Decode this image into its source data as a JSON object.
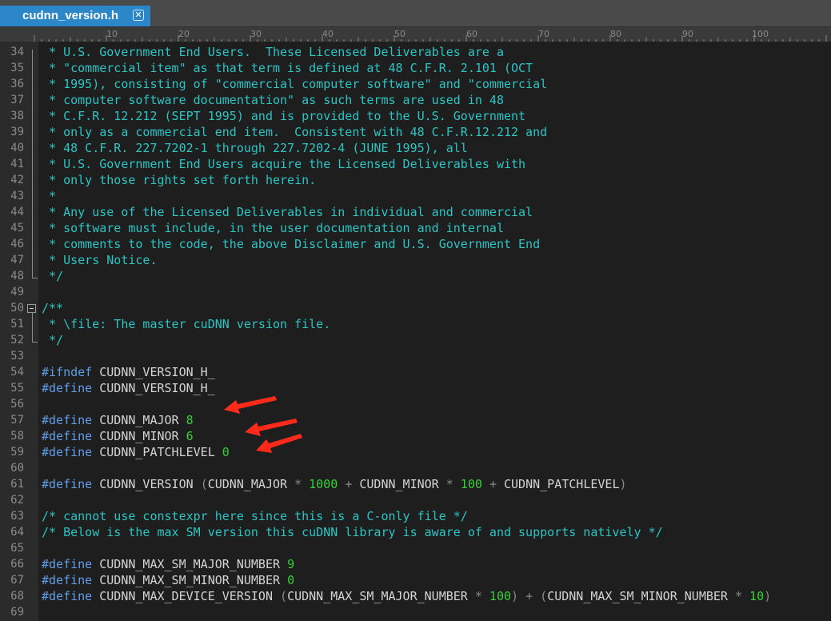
{
  "tab": {
    "title": "cudnn_version.h",
    "close_glyph": "✕"
  },
  "ruler": {
    "marks": [
      "10",
      "20",
      "30",
      "40",
      "50",
      "60",
      "70",
      "80",
      "90",
      "100"
    ]
  },
  "editor": {
    "lines": [
      {
        "num": "34",
        "tokens": [
          {
            "t": " * U.S. Government End Users.  These Licensed Deliverables are a",
            "c": "comment"
          }
        ]
      },
      {
        "num": "35",
        "tokens": [
          {
            "t": " * \"commercial item\" as that term is defined at 48 C.F.R. 2.101 (OCT",
            "c": "comment"
          }
        ]
      },
      {
        "num": "36",
        "tokens": [
          {
            "t": " * 1995), consisting of \"commercial computer software\" and \"commercial",
            "c": "comment"
          }
        ]
      },
      {
        "num": "37",
        "tokens": [
          {
            "t": " * computer software documentation\" as such terms are used in 48",
            "c": "comment"
          }
        ]
      },
      {
        "num": "38",
        "tokens": [
          {
            "t": " * C.F.R. 12.212 (SEPT 1995) and is provided to the U.S. Government",
            "c": "comment"
          }
        ]
      },
      {
        "num": "39",
        "tokens": [
          {
            "t": " * only as a commercial end item.  Consistent with 48 C.F.R.12.212 and",
            "c": "comment"
          }
        ]
      },
      {
        "num": "40",
        "tokens": [
          {
            "t": " * 48 C.F.R. 227.7202-1 through 227.7202-4 (JUNE 1995), all",
            "c": "comment"
          }
        ]
      },
      {
        "num": "41",
        "tokens": [
          {
            "t": " * U.S. Government End Users acquire the Licensed Deliverables with",
            "c": "comment"
          }
        ]
      },
      {
        "num": "42",
        "tokens": [
          {
            "t": " * only those rights set forth herein.",
            "c": "comment"
          }
        ]
      },
      {
        "num": "43",
        "tokens": [
          {
            "t": " *",
            "c": "comment"
          }
        ]
      },
      {
        "num": "44",
        "tokens": [
          {
            "t": " * Any use of the Licensed Deliverables in individual and commercial",
            "c": "comment"
          }
        ]
      },
      {
        "num": "45",
        "tokens": [
          {
            "t": " * software must include, in the user documentation and internal",
            "c": "comment"
          }
        ]
      },
      {
        "num": "46",
        "tokens": [
          {
            "t": " * comments to the code, the above Disclaimer and U.S. Government End",
            "c": "comment"
          }
        ]
      },
      {
        "num": "47",
        "tokens": [
          {
            "t": " * Users Notice.",
            "c": "comment"
          }
        ]
      },
      {
        "num": "48",
        "tokens": [
          {
            "t": " */",
            "c": "comment"
          }
        ]
      },
      {
        "num": "49",
        "tokens": []
      },
      {
        "num": "50",
        "tokens": [
          {
            "t": "/**",
            "c": "comment"
          }
        ]
      },
      {
        "num": "51",
        "tokens": [
          {
            "t": " * \\file: The master cuDNN version file.",
            "c": "comment"
          }
        ]
      },
      {
        "num": "52",
        "tokens": [
          {
            "t": " */",
            "c": "comment"
          }
        ]
      },
      {
        "num": "53",
        "tokens": []
      },
      {
        "num": "54",
        "tokens": [
          {
            "t": "#ifndef",
            "c": "pre"
          },
          {
            "t": " CUDNN_VERSION_H_",
            "c": "ident"
          }
        ]
      },
      {
        "num": "55",
        "tokens": [
          {
            "t": "#define",
            "c": "pre"
          },
          {
            "t": " CUDNN_VERSION_H_",
            "c": "ident"
          }
        ]
      },
      {
        "num": "56",
        "tokens": []
      },
      {
        "num": "57",
        "tokens": [
          {
            "t": "#define",
            "c": "pre"
          },
          {
            "t": " CUDNN_MAJOR ",
            "c": "ident"
          },
          {
            "t": "8",
            "c": "num"
          }
        ]
      },
      {
        "num": "58",
        "tokens": [
          {
            "t": "#define",
            "c": "pre"
          },
          {
            "t": " CUDNN_MINOR ",
            "c": "ident"
          },
          {
            "t": "6",
            "c": "num"
          }
        ]
      },
      {
        "num": "59",
        "tokens": [
          {
            "t": "#define",
            "c": "pre"
          },
          {
            "t": " CUDNN_PATCHLEVEL ",
            "c": "ident"
          },
          {
            "t": "0",
            "c": "num"
          }
        ]
      },
      {
        "num": "60",
        "tokens": []
      },
      {
        "num": "61",
        "tokens": [
          {
            "t": "#define",
            "c": "pre"
          },
          {
            "t": " CUDNN_VERSION ",
            "c": "ident"
          },
          {
            "t": "(",
            "c": "op"
          },
          {
            "t": "CUDNN_MAJOR ",
            "c": "ident"
          },
          {
            "t": "*",
            "c": "op"
          },
          {
            "t": " 1000 ",
            "c": "num"
          },
          {
            "t": "+",
            "c": "op"
          },
          {
            "t": " CUDNN_MINOR ",
            "c": "ident"
          },
          {
            "t": "*",
            "c": "op"
          },
          {
            "t": " 100 ",
            "c": "num"
          },
          {
            "t": "+",
            "c": "op"
          },
          {
            "t": " CUDNN_PATCHLEVEL",
            "c": "ident"
          },
          {
            "t": ")",
            "c": "op"
          }
        ]
      },
      {
        "num": "62",
        "tokens": []
      },
      {
        "num": "63",
        "tokens": [
          {
            "t": "/* cannot use constexpr here since this is a C-only file */",
            "c": "comment"
          }
        ]
      },
      {
        "num": "64",
        "tokens": [
          {
            "t": "/* Below is the max SM version this cuDNN library is aware of and supports natively */",
            "c": "comment"
          }
        ]
      },
      {
        "num": "65",
        "tokens": []
      },
      {
        "num": "66",
        "tokens": [
          {
            "t": "#define",
            "c": "pre"
          },
          {
            "t": " CUDNN_MAX_SM_MAJOR_NUMBER ",
            "c": "ident"
          },
          {
            "t": "9",
            "c": "num"
          }
        ]
      },
      {
        "num": "67",
        "tokens": [
          {
            "t": "#define",
            "c": "pre"
          },
          {
            "t": " CUDNN_MAX_SM_MINOR_NUMBER ",
            "c": "ident"
          },
          {
            "t": "0",
            "c": "num"
          }
        ]
      },
      {
        "num": "68",
        "tokens": [
          {
            "t": "#define",
            "c": "pre"
          },
          {
            "t": " CUDNN_MAX_DEVICE_VERSION ",
            "c": "ident"
          },
          {
            "t": "(",
            "c": "op"
          },
          {
            "t": "CUDNN_MAX_SM_MAJOR_NUMBER ",
            "c": "ident"
          },
          {
            "t": "*",
            "c": "op"
          },
          {
            "t": " 100",
            "c": "num"
          },
          {
            "t": ") + (",
            "c": "op"
          },
          {
            "t": "CUDNN_MAX_SM_MINOR_NUMBER ",
            "c": "ident"
          },
          {
            "t": "*",
            "c": "op"
          },
          {
            "t": " 10",
            "c": "num"
          },
          {
            "t": ")",
            "c": "op"
          }
        ]
      },
      {
        "num": "69",
        "tokens": []
      }
    ]
  },
  "colors": {
    "comment": "#2ec4c4",
    "preprocessor": "#5f9fe8",
    "identifier": "#d4d4d4",
    "number": "#37d037",
    "operator": "#8a8a8a",
    "annotation_arrow": "#ff2a1a",
    "tab_active": "#2c87c9"
  },
  "icons": {
    "fold_toggle": "minus-box-icon",
    "annotation": "red-arrow-icon"
  }
}
